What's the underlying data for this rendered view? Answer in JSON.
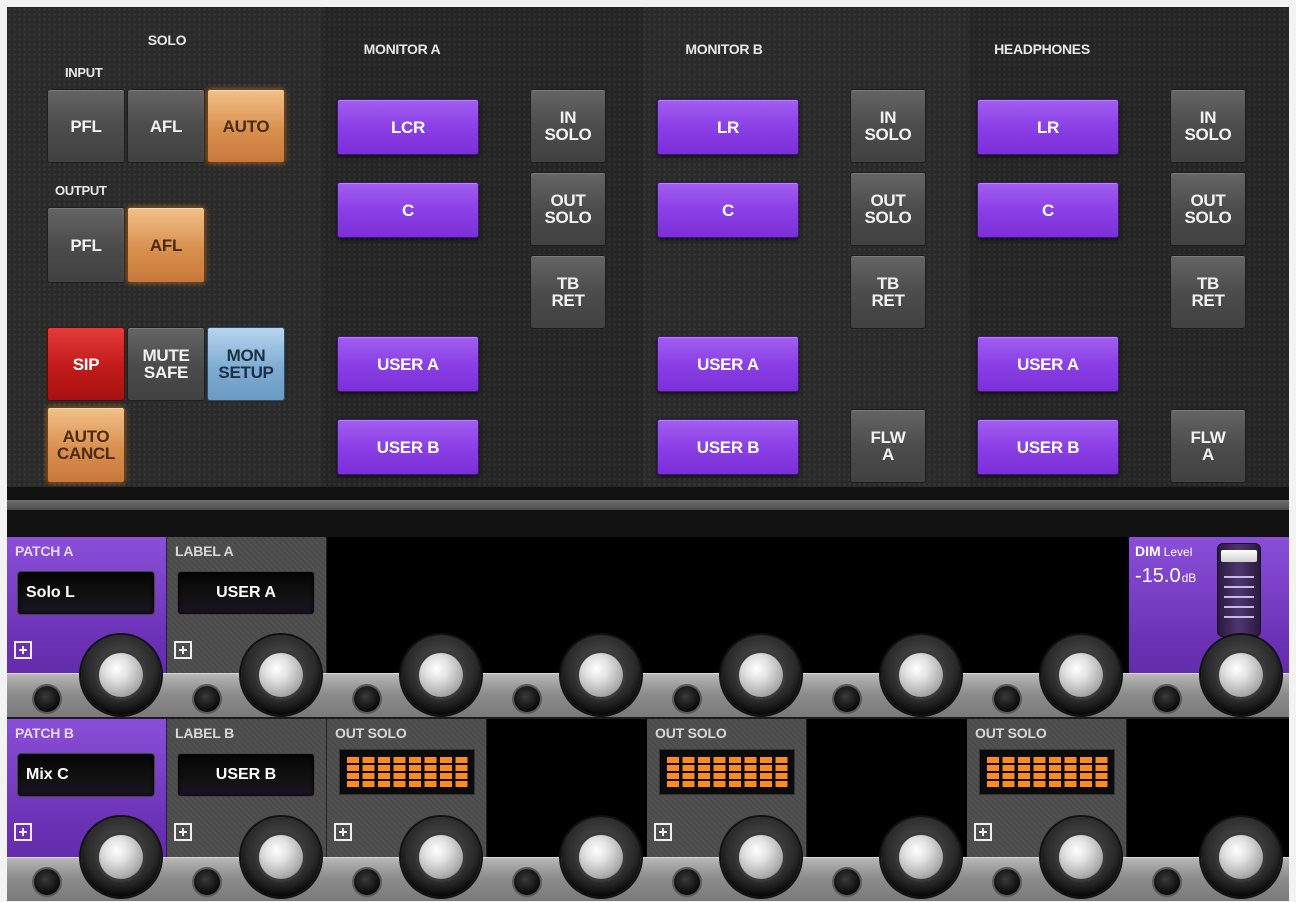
{
  "solo": {
    "title": "SOLO",
    "input_label": "INPUT",
    "output_label": "OUTPUT",
    "input_buttons": [
      "PFL",
      "AFL",
      "AUTO"
    ],
    "output_buttons": [
      "PFL",
      "AFL"
    ],
    "sip": "SIP",
    "mute_safe": "MUTE\nSAFE",
    "mon_setup": "MON\nSETUP",
    "auto_cancl": "AUTO\nCANCL"
  },
  "monitor_a": {
    "title": "MONITOR A",
    "source_buttons": [
      "LCR",
      "C",
      "USER A",
      "USER B"
    ],
    "side_buttons": [
      "IN\nSOLO",
      "OUT\nSOLO",
      "TB\nRET"
    ]
  },
  "monitor_b": {
    "title": "MONITOR B",
    "source_buttons": [
      "LR",
      "C",
      "USER A",
      "USER B"
    ],
    "side_buttons": [
      "IN\nSOLO",
      "OUT\nSOLO",
      "TB\nRET",
      "FLW\nA"
    ]
  },
  "headphones": {
    "title": "HEADPHONES",
    "source_buttons": [
      "LR",
      "C",
      "USER A",
      "USER B"
    ],
    "side_buttons": [
      "IN\nSOLO",
      "OUT\nSOLO",
      "TB\nRET",
      "FLW\nA"
    ]
  },
  "strip_a": {
    "patch_label": "PATCH A",
    "patch_value": "Solo L",
    "label_label": "LABEL A",
    "label_value": "USER A",
    "dim": {
      "title": "DIM",
      "level_word": "Level",
      "value": "-15.0",
      "unit": "dB"
    }
  },
  "strip_b": {
    "patch_label": "PATCH B",
    "patch_value": "Mix C",
    "label_label": "LABEL B",
    "label_value": "USER B",
    "out_solo_label": "OUT SOLO"
  },
  "colors": {
    "purple": "#8b3fe6",
    "orange": "#d9904f",
    "red": "#c21a1a",
    "blue": "#7eacd2",
    "meter": "#ff8a1e"
  }
}
